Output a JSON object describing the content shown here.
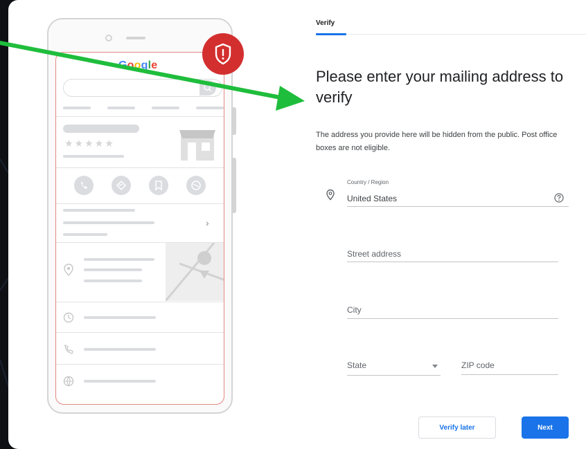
{
  "brand": {
    "logo_letters": [
      {
        "ch": "G",
        "color": "#4285F4"
      },
      {
        "ch": "o",
        "color": "#EA4335"
      },
      {
        "ch": "o",
        "color": "#FBBC05"
      },
      {
        "ch": "g",
        "color": "#4285F4"
      },
      {
        "ch": "l",
        "color": "#34A853"
      },
      {
        "ch": "e",
        "color": "#EA4335"
      }
    ],
    "stars": "★★★★★"
  },
  "tabs": {
    "verify_label": "Verify"
  },
  "form": {
    "title": "Please enter your mailing address to verify",
    "description": "The address you provide here will be hidden from the public. Post office boxes are not eligible.",
    "country_label": "Country / Region",
    "country_value": "United States",
    "street_placeholder": "Street address",
    "city_placeholder": "City",
    "state_placeholder": "State",
    "zip_placeholder": "ZIP code"
  },
  "buttons": {
    "verify_later": "Verify later",
    "next": "Next"
  },
  "colors": {
    "accent_blue": "#1a73e8",
    "arrow_green": "#1fbd3c",
    "shield_red": "#d32f2f",
    "phone_outline_red": "#e5877e"
  },
  "icons": [
    "shield-alert-icon",
    "location-pin-icon",
    "help-circle-icon",
    "phone-icon",
    "directions-icon",
    "bookmark-icon",
    "share-icon",
    "clock-icon",
    "globe-icon",
    "storefront-icon",
    "chevron-right-icon",
    "map-pin-icon"
  ]
}
